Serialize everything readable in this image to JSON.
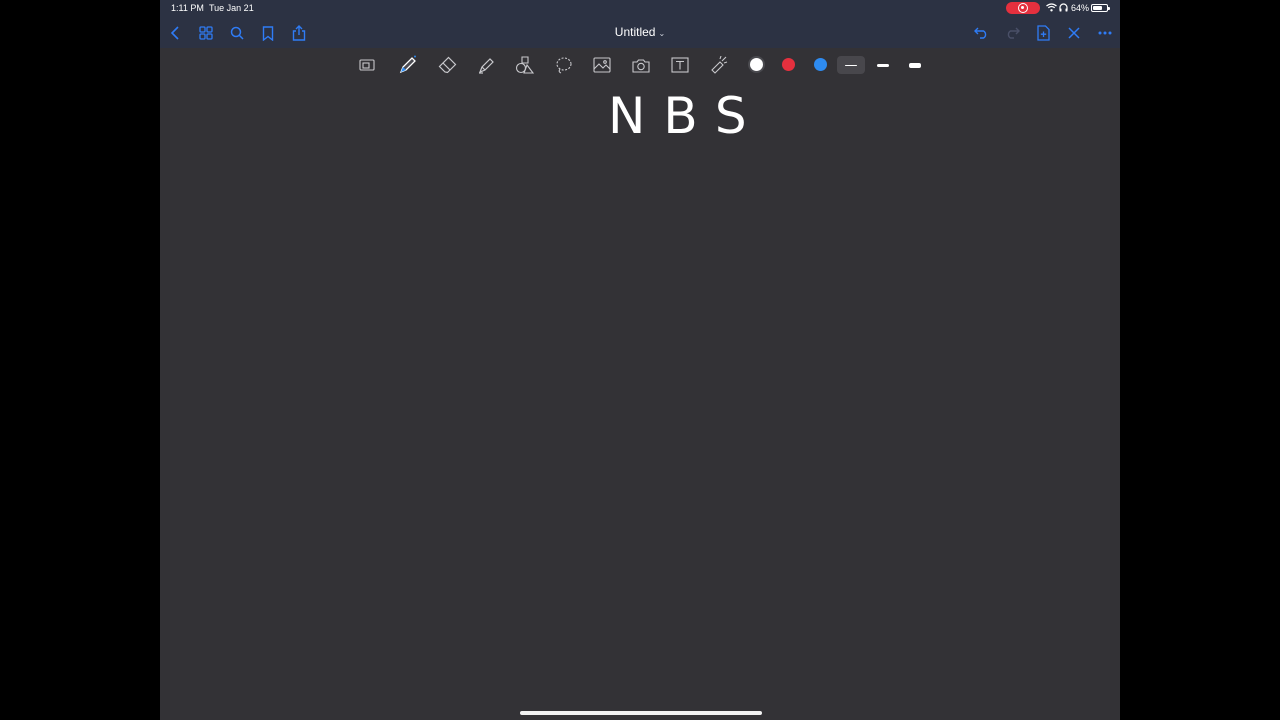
{
  "status_bar": {
    "time": "1:11 PM",
    "date": "Tue Jan 21",
    "battery": "64%",
    "recording_color": "#e5303e"
  },
  "nav_bar": {
    "title": "Untitled",
    "left_icons": [
      "back-chevron-icon",
      "grid-icon",
      "search-icon",
      "bookmark-icon",
      "share-icon"
    ],
    "right_icons": [
      "undo-icon",
      "redo-icon",
      "add-page-icon",
      "close-icon",
      "more-icon"
    ],
    "accent": "#2f7cf6"
  },
  "toolbar": {
    "tools": [
      "zoom-box-icon",
      "pen-icon",
      "eraser-icon",
      "highlighter-icon",
      "shapes-icon",
      "lasso-icon",
      "image-icon",
      "camera-icon",
      "text-icon",
      "laser-pointer-icon"
    ],
    "selected_tool": "pen-icon",
    "colors": [
      "#ffffff",
      "#e5303e",
      "#2e8bf0"
    ],
    "selected_color": "#ffffff",
    "stroke_widths": [
      "thin",
      "medium",
      "thick"
    ],
    "selected_stroke": "thin"
  },
  "canvas": {
    "handwritten_text": "NBS"
  }
}
